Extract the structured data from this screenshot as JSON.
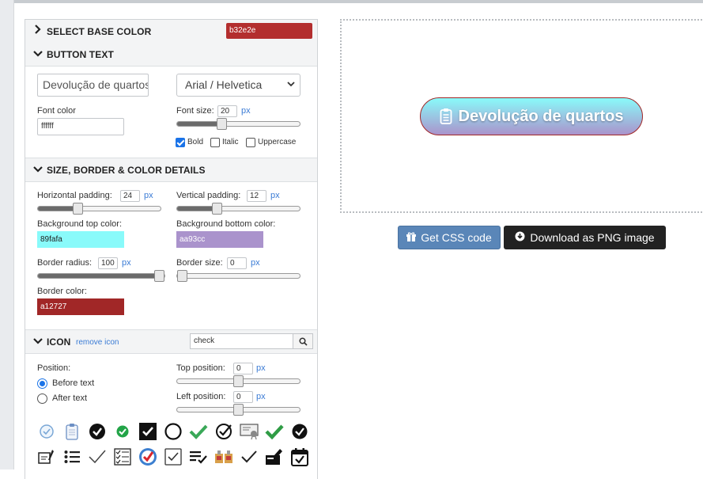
{
  "sections": {
    "base_color": {
      "title": "SELECT BASE COLOR",
      "value": "b32e2e",
      "color": "#b32e2e"
    },
    "button_text": {
      "title": "BUTTON TEXT",
      "text_value": "Devolução de quartos",
      "font_select": "Arial / Helvetica",
      "font_color_label": "Font color",
      "font_color_value": "ffffff",
      "font_size_label": "Font size:",
      "font_size_value": "20",
      "unit": "px",
      "font_size_slider": 0.35,
      "bold_label": "Bold",
      "bold_checked": true,
      "italic_label": "Italic",
      "uppercase_label": "Uppercase"
    },
    "details": {
      "title": "SIZE, BORDER & COLOR DETAILS",
      "hpad_label": "Horizontal padding:",
      "hpad_value": "24",
      "hpad_slider": 0.31,
      "vpad_label": "Vertical padding:",
      "vpad_value": "12",
      "vpad_slider": 0.31,
      "bg_top_label": "Background top color:",
      "bg_top_value": "89fafa",
      "bg_top_color": "#89fafa",
      "bg_bottom_label": "Background bottom color:",
      "bg_bottom_value": "aa93cc",
      "bg_bottom_color": "#aa93cc",
      "radius_label": "Border radius:",
      "radius_value": "100",
      "radius_slider": 1.0,
      "bsize_label": "Border size:",
      "bsize_value": "0",
      "bsize_slider": 0.0,
      "bcolor_label": "Border color:",
      "bcolor_value": "a12727",
      "bcolor_color": "#a12727"
    },
    "icon": {
      "title": "ICON",
      "remove_label": "remove icon",
      "search_value": "check",
      "position_label": "Position:",
      "before_label": "Before text",
      "after_label": "After text",
      "top_label": "Top position:",
      "top_value": "0",
      "top_slider": 0.5,
      "left_label": "Left position:",
      "left_value": "0",
      "left_slider": 0.5
    }
  },
  "preview": {
    "button_text": "Devolução de quartos"
  },
  "actions": {
    "css_label": "Get CSS code",
    "png_label": "Download as PNG image"
  }
}
